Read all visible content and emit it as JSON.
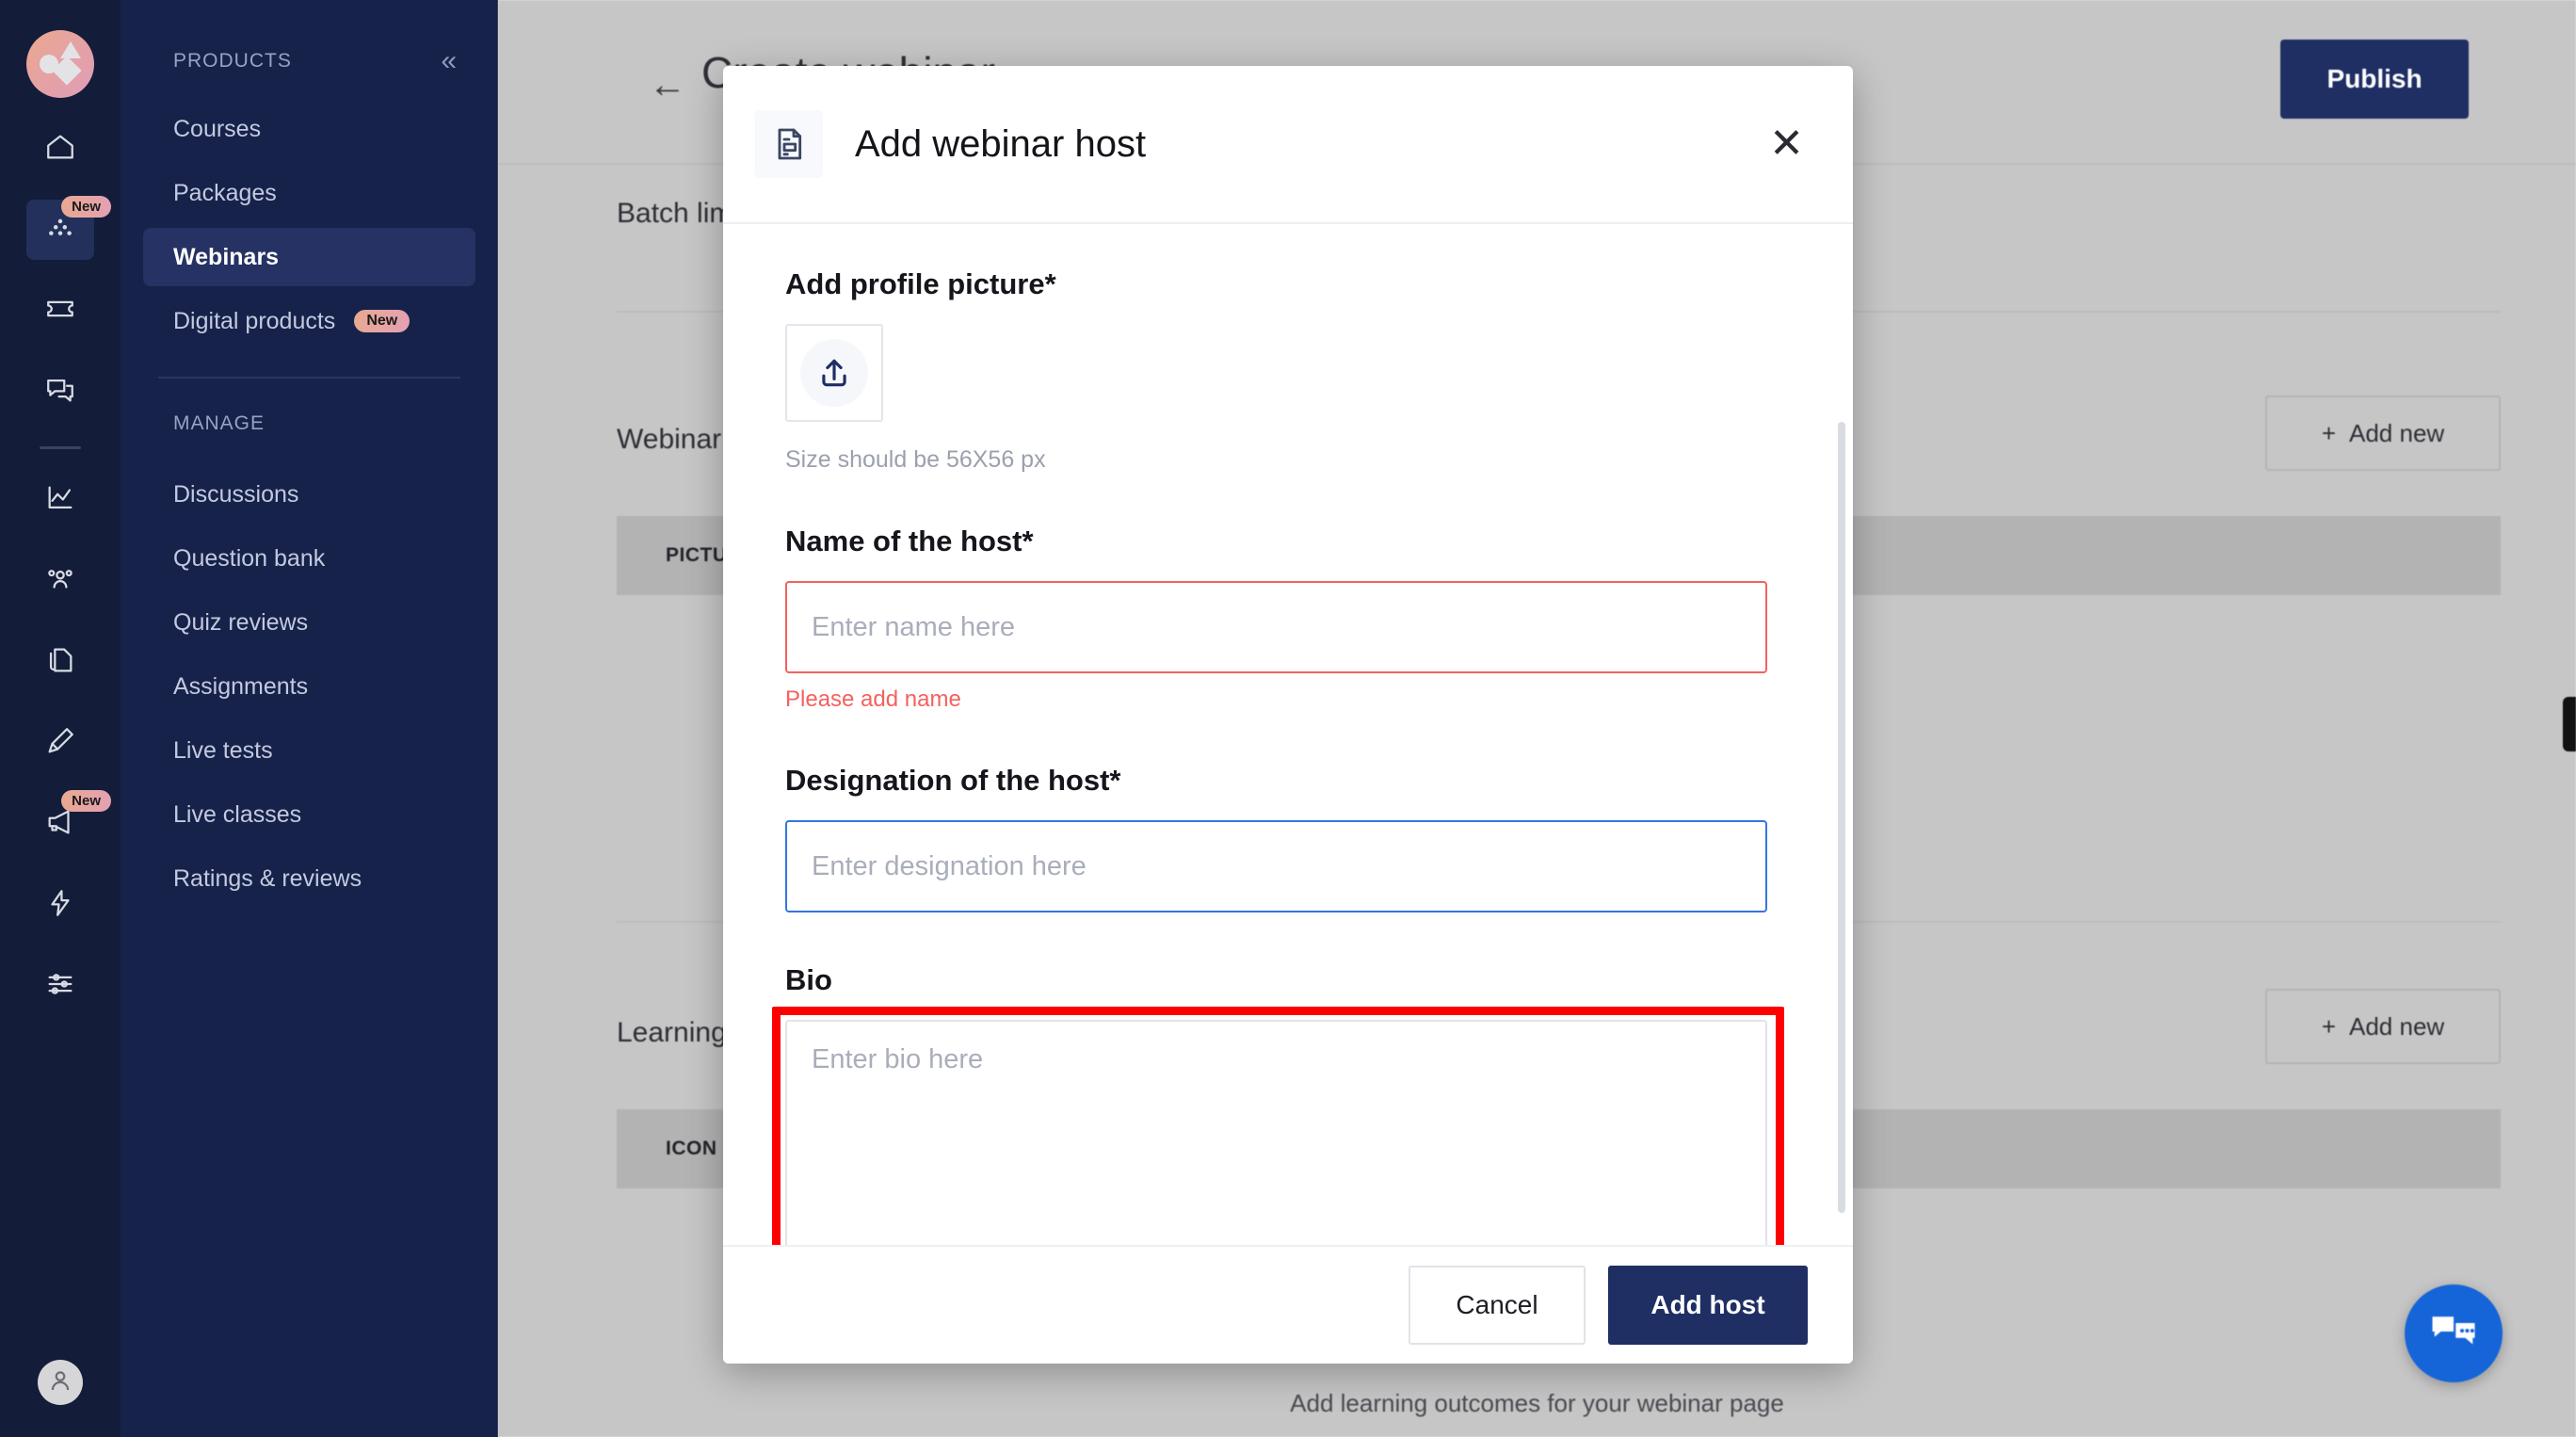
{
  "sidebar": {
    "rail_items": [
      {
        "name": "home-icon",
        "badge": null
      },
      {
        "name": "products-icon",
        "badge": "New"
      },
      {
        "name": "ticket-icon",
        "badge": null
      },
      {
        "name": "chat-icon",
        "badge": null
      },
      {
        "name": "analytics-icon",
        "badge": null
      },
      {
        "name": "people-icon",
        "badge": null
      },
      {
        "name": "documents-icon",
        "badge": null
      },
      {
        "name": "design-icon",
        "badge": null
      },
      {
        "name": "megaphone-icon",
        "badge": "New"
      },
      {
        "name": "lightning-icon",
        "badge": null
      },
      {
        "name": "settings-sliders-icon",
        "badge": null
      }
    ],
    "products_label": "PRODUCTS",
    "collapse_label": "«",
    "products_items": [
      {
        "label": "Courses",
        "badge": null,
        "active": false
      },
      {
        "label": "Packages",
        "badge": null,
        "active": false
      },
      {
        "label": "Webinars",
        "badge": null,
        "active": true
      },
      {
        "label": "Digital products",
        "badge": "New",
        "active": false
      }
    ],
    "manage_label": "MANAGE",
    "manage_items": [
      {
        "label": "Discussions"
      },
      {
        "label": "Question bank"
      },
      {
        "label": "Quiz reviews"
      },
      {
        "label": "Assignments"
      },
      {
        "label": "Live tests"
      },
      {
        "label": "Live classes"
      },
      {
        "label": "Ratings & reviews"
      }
    ]
  },
  "page": {
    "back_label": "←",
    "title": "Create webinar",
    "publish_label": "Publish",
    "section_batch": "Batch limit",
    "section_webinar": "Webinar hosts",
    "section_learning": "Learning outcomes",
    "add_new_label": "Add new",
    "add_new_icon": "plus-icon",
    "col_picture": "PICTURE",
    "col_icon": "ICON",
    "outcome_hint": "Add learning outcomes for your webinar page",
    "chat_icon": "chat-bubble-icon"
  },
  "modal": {
    "icon": "document-host-icon",
    "title": "Add webinar host",
    "close_label": "✕",
    "profile_picture": {
      "label": "Add profile picture*",
      "upload_icon": "upload-icon",
      "hint": "Size should be 56X56 px"
    },
    "name_field": {
      "label": "Name of the host*",
      "placeholder": "Enter name here",
      "value": "",
      "error": "Please add name"
    },
    "designation_field": {
      "label": "Designation of the host*",
      "placeholder": "Enter designation here",
      "value": ""
    },
    "bio_field": {
      "label": "Bio",
      "placeholder": "Enter bio here",
      "value": ""
    },
    "cancel_label": "Cancel",
    "submit_label": "Add host"
  },
  "colors": {
    "brand_navy": "#1f2e63",
    "sidebar_dark": "#131c38",
    "sidebar_panel": "#16224a",
    "error_red": "#f4615e",
    "focus_blue": "#3476e0",
    "highlight_red": "#ff0000",
    "chat_blue": "#1565d8"
  }
}
